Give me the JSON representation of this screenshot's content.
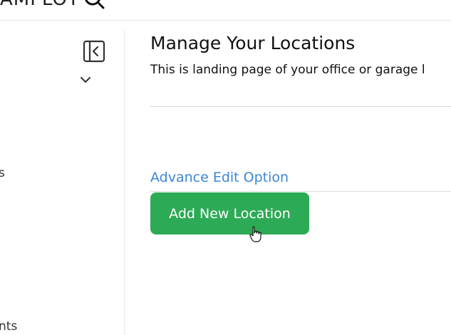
{
  "header": {
    "logo_fragment": "AMPLOT",
    "search_icon": "search-icon"
  },
  "sidebar": {
    "collapse_icon": "collapse-sidebar-icon",
    "chevron_icon": "chevron-down-icon",
    "fragments": [
      "s",
      "nts"
    ]
  },
  "main": {
    "title": "Manage Your Locations",
    "subtitle": "This is landing page of your office or garage l",
    "advance_edit_label": "Advance Edit Option",
    "add_button_label": "Add New Location"
  },
  "colors": {
    "accent_green": "#2daa55",
    "link_blue": "#3b86d6"
  }
}
